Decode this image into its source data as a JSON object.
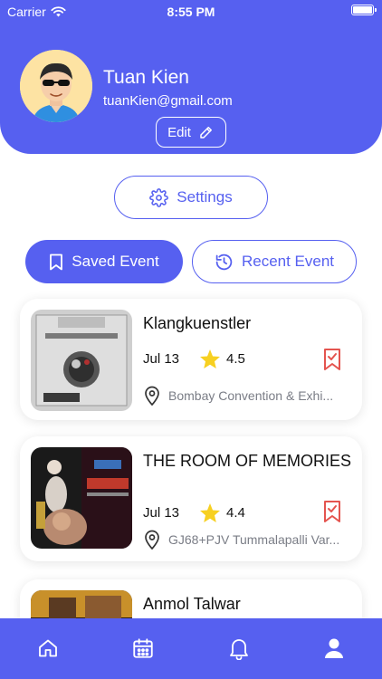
{
  "status_bar": {
    "carrier": "Carrier",
    "time": "8:55 PM"
  },
  "profile": {
    "name": "Tuan Kien",
    "email": "tuanKien@gmail.com",
    "edit_label": "Edit"
  },
  "settings_label": "Settings",
  "tabs": [
    {
      "label": "Saved Event",
      "active": true
    },
    {
      "label": "Recent Event",
      "active": false
    }
  ],
  "events": [
    {
      "title": "Klangkuenstler",
      "date": "Jul 13",
      "rating": "4.5",
      "location": "Bombay Convention & Exhi..."
    },
    {
      "title": "THE ROOM OF MEMORIES",
      "date": "Jul 13",
      "rating": "4.4",
      "location": "GJ68+PJV Tummalapalli Var..."
    },
    {
      "title": "Anmol Talwar",
      "date": "",
      "rating": "",
      "location": ""
    }
  ],
  "bottom_nav": [
    "home-icon",
    "calendar-icon",
    "bell-icon",
    "profile-icon"
  ],
  "colors": {
    "primary": "#5660f0",
    "bookmark": "#e4544f",
    "star": "#f7d021",
    "muted": "#7a7d86"
  }
}
